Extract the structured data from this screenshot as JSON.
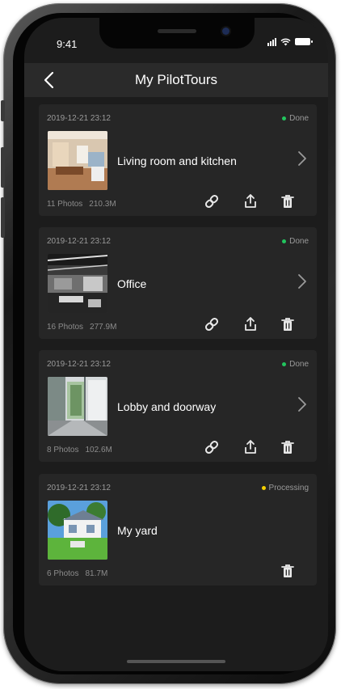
{
  "status_bar": {
    "time": "9:41"
  },
  "header": {
    "title": "My PilotTours"
  },
  "colors": {
    "done": "#22c55e",
    "processing": "#f5d000"
  },
  "tours": [
    {
      "date": "2019-12-21 23:12",
      "status": "Done",
      "status_color": "#22c55e",
      "name": "Living room and kitchen",
      "photos": "11 Photos",
      "size": "210.3M",
      "has_link": true,
      "has_share": true,
      "has_chevron": true
    },
    {
      "date": "2019-12-21 23:12",
      "status": "Done",
      "status_color": "#22c55e",
      "name": "Office",
      "photos": "16 Photos",
      "size": "277.9M",
      "has_link": true,
      "has_share": true,
      "has_chevron": true
    },
    {
      "date": "2019-12-21 23:12",
      "status": "Done",
      "status_color": "#22c55e",
      "name": "Lobby and doorway",
      "photos": "8 Photos",
      "size": "102.6M",
      "has_link": true,
      "has_share": true,
      "has_chevron": true
    },
    {
      "date": "2019-12-21 23:12",
      "status": "Processing",
      "status_color": "#f5d000",
      "name": "My yard",
      "photos": "6 Photos",
      "size": "81.7M",
      "has_link": false,
      "has_share": false,
      "has_chevron": false
    }
  ],
  "icons": [
    "back-icon",
    "link-icon",
    "share-icon",
    "trash-icon",
    "chevron-right-icon"
  ]
}
